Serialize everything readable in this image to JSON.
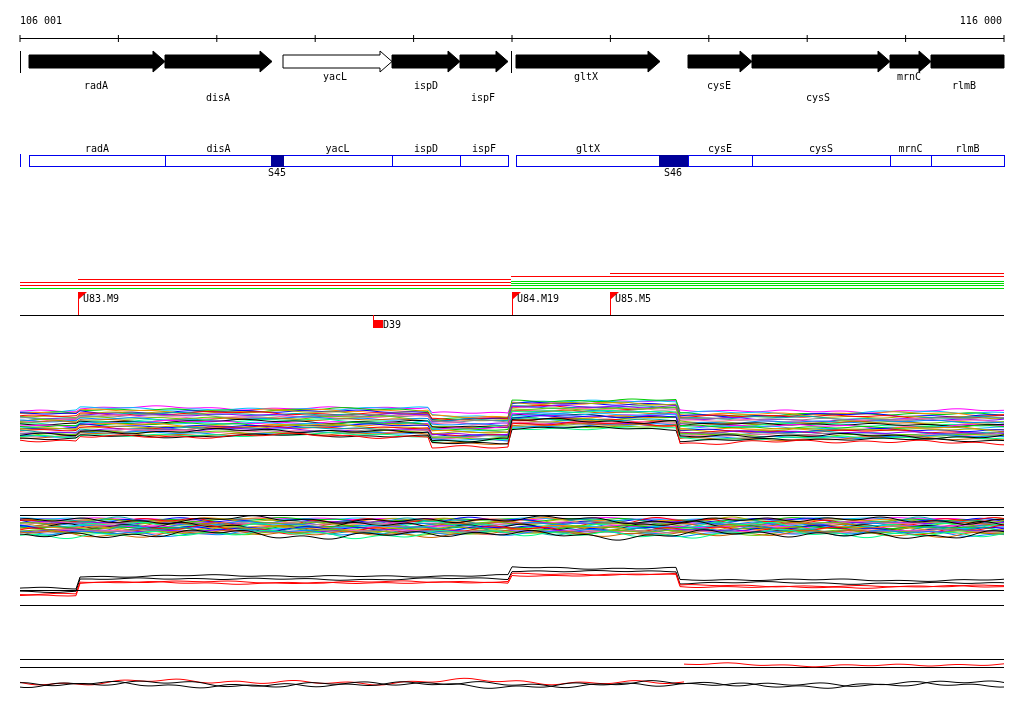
{
  "axis": {
    "start_label": "106 001",
    "end_label": "116 000"
  },
  "genes": [
    {
      "name": "radA",
      "outlined": false
    },
    {
      "name": "disA",
      "outlined": false
    },
    {
      "name": "yacL",
      "outlined": true
    },
    {
      "name": "ispD",
      "outlined": false
    },
    {
      "name": "ispF",
      "outlined": false
    },
    {
      "name": "gltX",
      "outlined": false
    },
    {
      "name": "cysE",
      "outlined": false
    },
    {
      "name": "cysS",
      "outlined": false
    },
    {
      "name": "mrnC",
      "outlined": false
    },
    {
      "name": "rlmB",
      "outlined": false
    }
  ],
  "gene_boxes": [
    {
      "name": "radA"
    },
    {
      "name": "disA"
    },
    {
      "name": "yacL"
    },
    {
      "name": "ispD"
    },
    {
      "name": "ispF"
    },
    {
      "name": "gltX"
    },
    {
      "name": "cysE"
    },
    {
      "name": "cysS"
    },
    {
      "name": "mrnC"
    },
    {
      "name": "rlmB"
    }
  ],
  "sites": [
    {
      "label": "S45"
    },
    {
      "label": "S46"
    }
  ],
  "markers": [
    {
      "label": "U83.M9"
    },
    {
      "label": "U84.M19"
    },
    {
      "label": "U85.M5"
    }
  ],
  "deletions": [
    {
      "label": "D39"
    }
  ]
}
